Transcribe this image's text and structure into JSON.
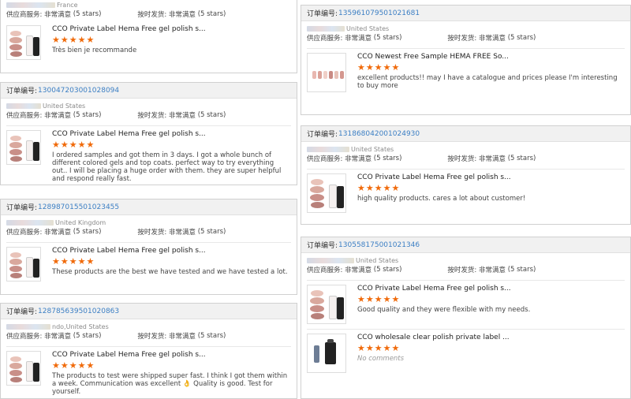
{
  "left": {
    "top_card": {
      "buyer": "France",
      "rating_service_label": "供应商服务: 非常满意",
      "rating_service_stars": "(5 stars)",
      "rating_ship_label": "按时发货: 非常满意",
      "rating_ship_stars": "(5 stars)",
      "product": "CCO Private Label Hema Free gel polish s...",
      "stars": "★★★★★",
      "review": "Très bien je recommande"
    },
    "cards": [
      {
        "order_label": "订单编号:",
        "order_no": "130047203001028094",
        "buyer": "United States",
        "rating_service_label": "供应商服务: 非常满意",
        "rating_service_stars": "(5 stars)",
        "rating_ship_label": "按时发货: 非常满意",
        "rating_ship_stars": "(5 stars)",
        "product": "CCO Private Label Hema Free gel polish s...",
        "stars": "★★★★★",
        "review": "I ordered samples and got them in 3 days. I got a whole bunch of different colored gels and top coats. perfect way to try everything out.. I will be placing a huge order with them. they are super helpful and respond really fast."
      },
      {
        "order_label": "订单编号:",
        "order_no": "128987015501023455",
        "buyer": "United Kingdom",
        "rating_service_label": "供应商服务: 非常满意",
        "rating_service_stars": "(5 stars)",
        "rating_ship_label": "按时发货: 非常满意",
        "rating_ship_stars": "(5 stars)",
        "product": "CCO Private Label Hema Free gel polish s...",
        "stars": "★★★★★",
        "review": "These products are the best we have tested and we have tested a lot."
      },
      {
        "order_label": "订单编号:",
        "order_no": "128785639501020863",
        "buyer": "ndo,United States",
        "rating_service_label": "供应商服务: 非常满意",
        "rating_service_stars": "(5 stars)",
        "rating_ship_label": "按时发货: 非常满意",
        "rating_ship_stars": "(5 stars)",
        "product": "CCO Private Label Hema Free gel polish s...",
        "stars": "★★★★★",
        "review": "The products to test were shipped super fast. I think I got them within a week. Communication was excellent 👌 Quality is good. Test for yourself."
      }
    ]
  },
  "right": {
    "cards": [
      {
        "order_label": "订单编号:",
        "order_no": "135961079501021681",
        "buyer": "United States",
        "rating_service_label": "供应商服务: 非常满意",
        "rating_service_stars": "(5 stars)",
        "rating_ship_label": "按时发货: 非常满意",
        "rating_ship_stars": "(5 stars)",
        "product": "CCO Newest Free Sample HEMA FREE So...",
        "stars": "★★★★★",
        "review": "excellent products!! may I have a catalogue and prices please I'm interesting to buy more"
      },
      {
        "order_label": "订单编号:",
        "order_no": "131868042001024930",
        "buyer": "United States",
        "rating_service_label": "供应商服务: 非常满意",
        "rating_service_stars": "(5 stars)",
        "rating_ship_label": "按时发货: 非常满意",
        "rating_ship_stars": "(5 stars)",
        "product": "CCO Private Label Hema Free gel polish s...",
        "stars": "★★★★★",
        "review": "high quality products. cares a lot about customer!"
      },
      {
        "order_label": "订单编号:",
        "order_no": "130558175001021346",
        "buyer": "United States",
        "rating_service_label": "供应商服务: 非常满意",
        "rating_service_stars": "(5 stars)",
        "rating_ship_label": "按时发货: 非常满意",
        "rating_ship_stars": "(5 stars)",
        "product": "CCO Private Label Hema Free gel polish s...",
        "stars": "★★★★★",
        "review": "Good quality and they were flexible with my needs.",
        "product2": "CCO wholesale clear polish private label ...",
        "stars2": "★★★★★",
        "review2": "No comments"
      }
    ]
  },
  "colors": {
    "accent_link": "#3c7fc4",
    "star": "#f06a0a",
    "bar_bg": "#f1f1f1"
  }
}
